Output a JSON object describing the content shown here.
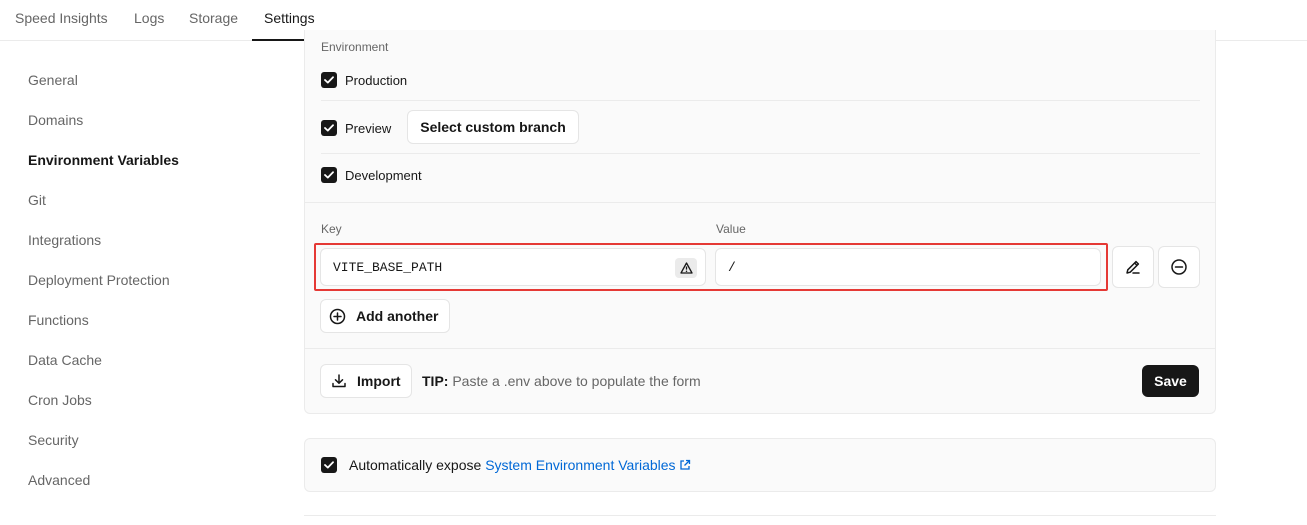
{
  "tabs": [
    {
      "label": "Speed Insights"
    },
    {
      "label": "Logs"
    },
    {
      "label": "Storage"
    },
    {
      "label": "Settings",
      "active": true
    }
  ],
  "sidebar": {
    "items": [
      {
        "label": "General"
      },
      {
        "label": "Domains"
      },
      {
        "label": "Environment Variables",
        "active": true
      },
      {
        "label": "Git"
      },
      {
        "label": "Integrations"
      },
      {
        "label": "Deployment Protection"
      },
      {
        "label": "Functions"
      },
      {
        "label": "Data Cache"
      },
      {
        "label": "Cron Jobs"
      },
      {
        "label": "Security"
      },
      {
        "label": "Advanced"
      }
    ]
  },
  "environment": {
    "label": "Environment",
    "production": "Production",
    "preview": "Preview",
    "select_branch": "Select custom branch",
    "development": "Development"
  },
  "vars": {
    "key_label": "Key",
    "value_label": "Value",
    "key_value": "VITE_BASE_PATH",
    "value_value": "/",
    "add_another": "Add another"
  },
  "footer": {
    "import_label": "Import",
    "tip_label": "TIP:",
    "tip_text": "Paste a .env above to populate the form",
    "save_label": "Save"
  },
  "expose": {
    "text": "Automatically expose",
    "link": "System Environment Variables"
  },
  "colors": {
    "accent_link": "#0068d6",
    "highlight": "#e53935",
    "primary_button": "#171717"
  }
}
